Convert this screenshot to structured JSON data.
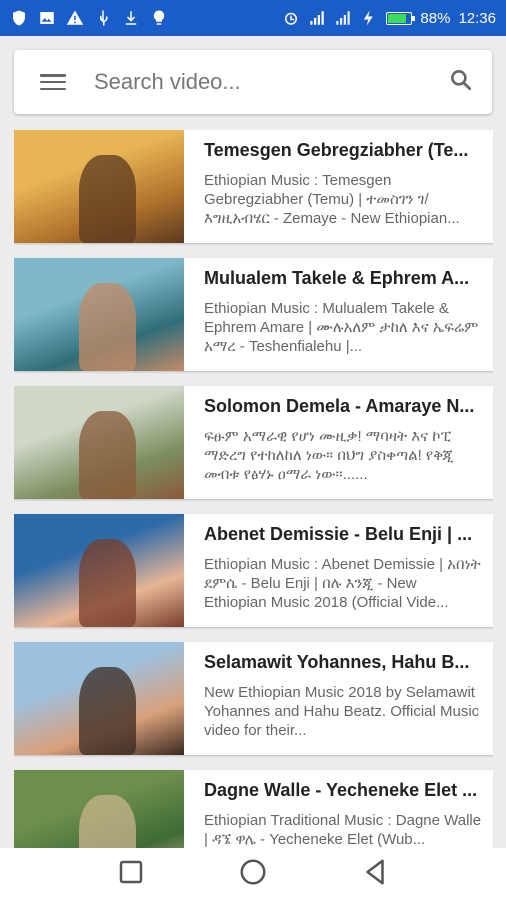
{
  "status": {
    "battery_percent_label": "88%",
    "battery_level": 0.88,
    "time": "12:36",
    "left_icons": [
      "shield-icon",
      "image-icon",
      "warning-icon",
      "usb-icon",
      "download-icon",
      "lightbulb-icon"
    ],
    "right_icons": [
      "alarm-icon",
      "signal-icon",
      "signal-4g-icon",
      "charging-icon",
      "battery-icon"
    ]
  },
  "search": {
    "placeholder": "Search video..."
  },
  "videos": [
    {
      "title": "Temesgen Gebregziabher (Te...",
      "description": "Ethiopian Music : Temesgen Gebregziabher (Temu) | ተመስገን ገ/እግዚአብሄር - Zemaye - New Ethiopian...",
      "thumb_colors": [
        "#e8b455",
        "#b0722c",
        "#5b3a1f"
      ]
    },
    {
      "title": "Mulualem Takele & Ephrem A...",
      "description": "Ethiopian Music : Mulualem Takele & Ephrem Amare | ሙሉአለም ታከለ እና ኤፍሬም አማረ - Teshenfialehu |...",
      "thumb_colors": [
        "#7fb9c9",
        "#2f6f7a",
        "#c48a66"
      ]
    },
    {
      "title": "Solomon Demela - Amaraye N...",
      "description": "ፍፁም አማራዊ የሆነ ሙዚቃ! ማባዛት እና ኮፒ ማድረግ የተከለከለ ነው። በህግ ያስቀጣል! የቅጂ መብቱ የፅሃኑ ዐማራ ነው።......",
      "thumb_colors": [
        "#cfd7c8",
        "#7c8f60",
        "#8a5a3a"
      ]
    },
    {
      "title": "Abenet Demissie - Belu Enji | ...",
      "description": "Ethiopian Music : Abenet Demissie | አበነት ደምሴ - Belu Enji | በሉ እንጂ - New Ethiopian Music 2018 (Official Vide...",
      "thumb_colors": [
        "#2d6aa8",
        "#e7b595",
        "#7a3e2a"
      ]
    },
    {
      "title": "Selamawit Yohannes, Hahu B...",
      "description": "New Ethiopian Music 2018 by Selamawit Yohannes and Hahu Beatz. Official Music video for their...",
      "thumb_colors": [
        "#9cc2e0",
        "#d9a07a",
        "#3a2a22"
      ]
    },
    {
      "title": "Dagne Walle - Yecheneke Elet ...",
      "description": "Ethiopian Traditional Music : Dagne Walle | ዳኜ ዋሌ - Yecheneke Elet (Wub...",
      "thumb_colors": [
        "#6d8f4e",
        "#3f6b35",
        "#c9b48e"
      ]
    }
  ],
  "nav": {
    "icons": [
      "recent-apps-icon",
      "home-icon",
      "back-icon"
    ]
  },
  "colors": {
    "status_bar": "#1a5cc8",
    "background": "#ececec",
    "card": "#ffffff"
  }
}
